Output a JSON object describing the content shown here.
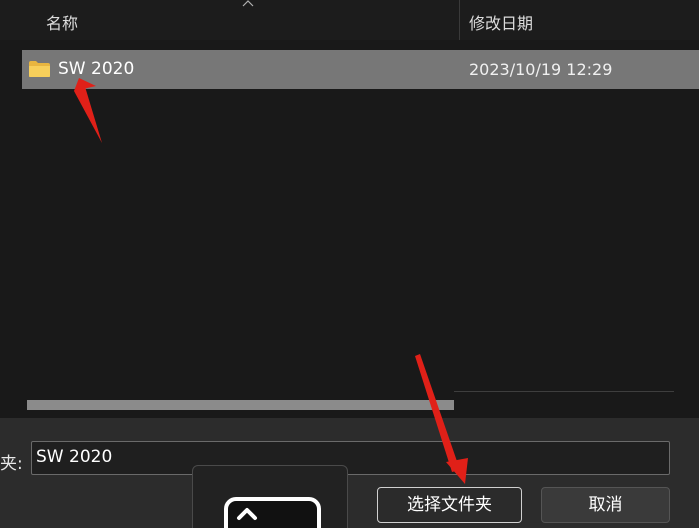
{
  "header": {
    "col_name": "名称",
    "col_date": "修改日期",
    "sort_icon": "chevron-up-icon"
  },
  "rows": [
    {
      "name": "SW 2020",
      "modified": "2023/10/19 12:29",
      "icon": "folder-icon",
      "selected": true
    }
  ],
  "footer": {
    "folder_label": "夹:",
    "folder_value": "SW 2020",
    "select_button": "选择文件夹",
    "cancel_button": "取消"
  },
  "colors": {
    "background": "#191919",
    "selected_row": "#777777",
    "annotation_arrow": "#e02018"
  }
}
